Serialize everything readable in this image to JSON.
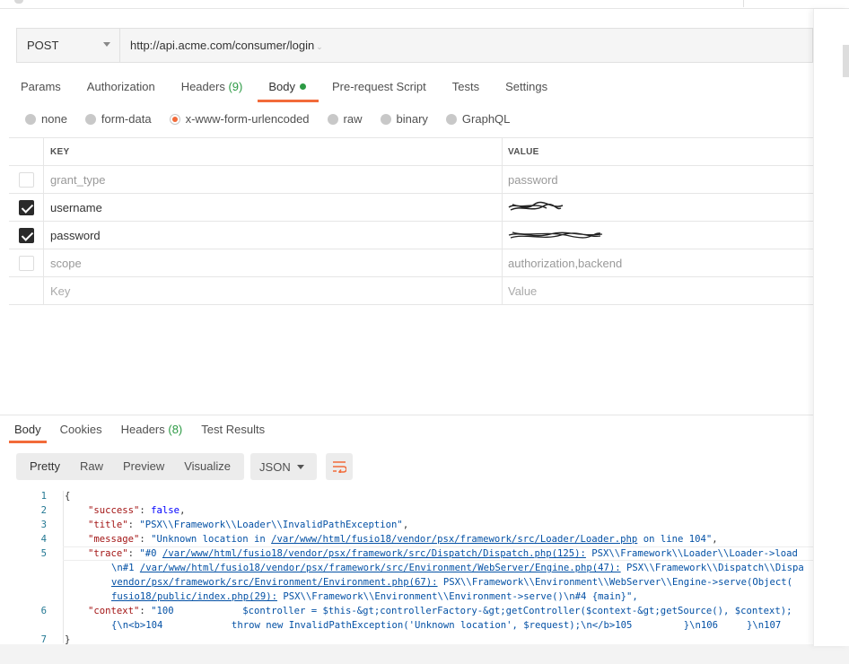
{
  "request": {
    "method": "POST",
    "url": "http://api.acme.com/consumer/login"
  },
  "req_tabs": [
    {
      "label": "Params"
    },
    {
      "label": "Authorization"
    },
    {
      "label": "Headers",
      "count": "(9)"
    },
    {
      "label": "Body"
    },
    {
      "label": "Pre-request Script"
    },
    {
      "label": "Tests"
    },
    {
      "label": "Settings"
    }
  ],
  "body_types": [
    "none",
    "form-data",
    "x-www-form-urlencoded",
    "raw",
    "binary",
    "GraphQL"
  ],
  "body_selected": "x-www-form-urlencoded",
  "kv": {
    "key_header": "KEY",
    "value_header": "VALUE",
    "rows": [
      {
        "checked": false,
        "key": "grant_type",
        "value": "password"
      },
      {
        "checked": true,
        "key": "username",
        "value": ""
      },
      {
        "checked": true,
        "key": "password",
        "value": ""
      },
      {
        "checked": false,
        "key": "scope",
        "value": "authorization,backend"
      }
    ],
    "key_placeholder": "Key",
    "value_placeholder": "Value"
  },
  "resp_tabs": [
    {
      "label": "Body"
    },
    {
      "label": "Cookies"
    },
    {
      "label": "Headers",
      "count": "(8)"
    },
    {
      "label": "Test Results"
    }
  ],
  "view_modes": [
    "Pretty",
    "Raw",
    "Preview",
    "Visualize"
  ],
  "format": "JSON",
  "code_lines": [
    "1",
    "2",
    "3",
    "4",
    "5",
    "6",
    "7"
  ],
  "code": {
    "l1": "{",
    "l2_key": "\"success\"",
    "l2_val": "false",
    "l3_key": "\"title\"",
    "l3_val": "\"PSX\\\\Framework\\\\Loader\\\\InvalidPathException\"",
    "l4_key": "\"message\"",
    "l4_a": "\"Unknown location in ",
    "l4_path": "/var/www/html/fusio18/vendor/psx/framework/src/Loader/Loader.php",
    "l4_b": " on line 104\"",
    "l5_key": "\"trace\"",
    "l5_a": "\"#0 ",
    "l5_path": "/var/www/html/fusio18/vendor/psx/framework/src/Dispatch/Dispatch.php(125):",
    "l5_b": " PSX\\\\Framework\\\\Loader\\\\Loader->load",
    "l5b_a": "\\n#1 ",
    "l5b_path": "/var/www/html/fusio18/vendor/psx/framework/src/Environment/WebServer/Engine.php(47):",
    "l5b_b": " PSX\\\\Framework\\\\Dispatch\\\\Dispa",
    "l5c_path": "vendor/psx/framework/src/Environment/Environment.php(67):",
    "l5c_b": " PSX\\\\Framework\\\\Environment\\\\WebServer\\\\Engine->serve(Object(",
    "l5d_path": "fusio18/public/index.php(29):",
    "l5d_b": " PSX\\\\Framework\\\\Environment\\\\Environment->serve()\\n#4 {main}\",",
    "l6_key": "\"context\"",
    "l6_a": "\"100            $controller = $this-&gt;controllerFactory-&gt;getController($context-&gt;getSource(), $context);",
    "l6b": "{\\n<b>104            throw new InvalidPathException('Unknown location', $request);\\n</b>105         }\\n106     }\\n107",
    "l7": "}"
  },
  "colors": {
    "accent": "#f26b3a",
    "count_green": "#2c9a44",
    "json_key": "#a31515",
    "json_string": "#0451a5"
  }
}
